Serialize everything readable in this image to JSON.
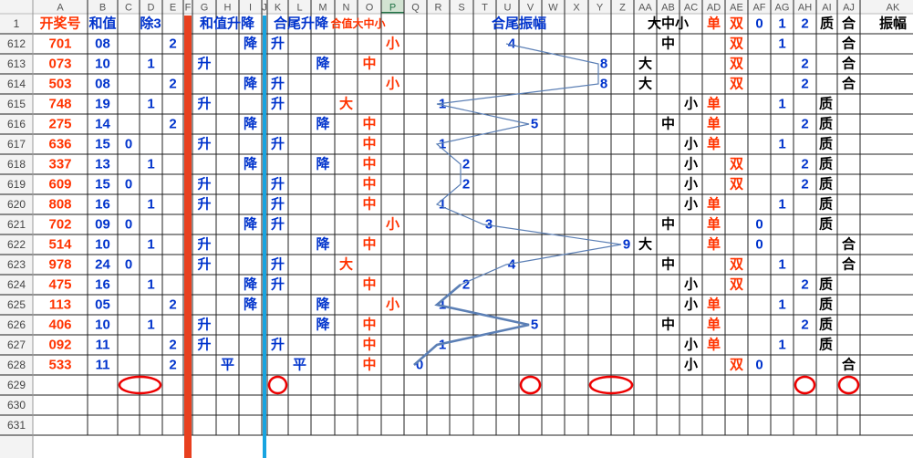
{
  "columns": [
    "A",
    "B",
    "C",
    "D",
    "E",
    "F",
    "G",
    "H",
    "I",
    "J",
    "K",
    "L",
    "M",
    "N",
    "O",
    "P",
    "Q",
    "R",
    "S",
    "T",
    "U",
    "V",
    "W",
    "X",
    "Y",
    "Z",
    "AA",
    "AB",
    "AC",
    "AD",
    "AE",
    "AF",
    "AG",
    "AH",
    "AI",
    "AJ",
    "AK"
  ],
  "selected_column": "P",
  "header_row": {
    "row_number": "1",
    "cells": [
      {
        "col": "A",
        "text": "开奖号",
        "color": "#ff3300"
      },
      {
        "col": "B",
        "text": "和值",
        "color": "#0033cc"
      },
      {
        "col": "C",
        "span": "E",
        "text": "除3",
        "color": "#0033cc"
      },
      {
        "col": "G",
        "span": "I",
        "text": "和值升降",
        "color": "#0033cc"
      },
      {
        "col": "K",
        "span": "M",
        "text": "合尾升降",
        "color": "#0033cc"
      },
      {
        "col": "N",
        "span": "O",
        "text": "合值大中小",
        "color": "#ff3300",
        "small": true
      },
      {
        "col": "Q",
        "span": "Z",
        "text": "合尾振幅",
        "color": "#0033cc"
      },
      {
        "col": "AA",
        "span": "AC",
        "text": "大中小",
        "color": "#000000"
      },
      {
        "col": "AD",
        "text": "单",
        "color": "#ff3300"
      },
      {
        "col": "AE",
        "text": "双",
        "color": "#ff3300"
      },
      {
        "col": "AF",
        "text": "0",
        "color": "#0033cc"
      },
      {
        "col": "AG",
        "text": "1",
        "color": "#0033cc"
      },
      {
        "col": "AH",
        "text": "2",
        "color": "#0033cc"
      },
      {
        "col": "AI",
        "text": "质",
        "color": "#000000"
      },
      {
        "col": "AJ",
        "text": "合",
        "color": "#000000"
      },
      {
        "col": "AK",
        "text": "振幅",
        "color": "#000000"
      }
    ]
  },
  "rows": [
    {
      "row": "612",
      "number": "701",
      "sum": "08",
      "mod3": {
        "col": "E",
        "v": "2"
      },
      "sum_trend": {
        "col": "I",
        "v": "降"
      },
      "tail_trend": {
        "col": "K",
        "v": "升"
      },
      "size": {
        "col": "P",
        "v": "小"
      },
      "amp": "4",
      "dzx": {
        "col": "AB",
        "v": "中"
      },
      "parity": {
        "col": "AE",
        "v": "双"
      },
      "r3": {
        "col": "AG",
        "v": "1"
      },
      "pc": "合"
    },
    {
      "row": "613",
      "number": "073",
      "sum": "10",
      "mod3": {
        "col": "D",
        "v": "1"
      },
      "sum_trend": {
        "col": "G",
        "v": "升"
      },
      "tail_trend": {
        "col": "M",
        "v": "降"
      },
      "size": {
        "col": "O",
        "v": "中"
      },
      "amp": "8",
      "dzx": {
        "col": "AA",
        "v": "大"
      },
      "parity": {
        "col": "AE",
        "v": "双"
      },
      "r3": {
        "col": "AH",
        "v": "2"
      },
      "pc": "合"
    },
    {
      "row": "614",
      "number": "503",
      "sum": "08",
      "mod3": {
        "col": "E",
        "v": "2"
      },
      "sum_trend": {
        "col": "I",
        "v": "降"
      },
      "tail_trend": {
        "col": "K",
        "v": "升"
      },
      "size": {
        "col": "P",
        "v": "小"
      },
      "amp": "8",
      "dzx": {
        "col": "AA",
        "v": "大"
      },
      "parity": {
        "col": "AE",
        "v": "双"
      },
      "r3": {
        "col": "AH",
        "v": "2"
      },
      "pc": "合"
    },
    {
      "row": "615",
      "number": "748",
      "sum": "19",
      "mod3": {
        "col": "D",
        "v": "1"
      },
      "sum_trend": {
        "col": "G",
        "v": "升"
      },
      "tail_trend": {
        "col": "K",
        "v": "升"
      },
      "size": {
        "col": "N",
        "v": "大"
      },
      "amp": "1",
      "dzx": {
        "col": "AC",
        "v": "小"
      },
      "parity": {
        "col": "AD",
        "v": "单"
      },
      "r3": {
        "col": "AG",
        "v": "1"
      },
      "pc": "质"
    },
    {
      "row": "616",
      "number": "275",
      "sum": "14",
      "mod3": {
        "col": "E",
        "v": "2"
      },
      "sum_trend": {
        "col": "I",
        "v": "降"
      },
      "tail_trend": {
        "col": "M",
        "v": "降"
      },
      "size": {
        "col": "O",
        "v": "中"
      },
      "amp": "5",
      "dzx": {
        "col": "AB",
        "v": "中"
      },
      "parity": {
        "col": "AD",
        "v": "单"
      },
      "r3": {
        "col": "AH",
        "v": "2"
      },
      "pc": "质"
    },
    {
      "row": "617",
      "number": "636",
      "sum": "15",
      "mod3": {
        "col": "C",
        "v": "0"
      },
      "sum_trend": {
        "col": "G",
        "v": "升"
      },
      "tail_trend": {
        "col": "K",
        "v": "升"
      },
      "size": {
        "col": "O",
        "v": "中"
      },
      "amp": "1",
      "dzx": {
        "col": "AC",
        "v": "小"
      },
      "parity": {
        "col": "AD",
        "v": "单"
      },
      "r3": {
        "col": "AG",
        "v": "1"
      },
      "pc": "质"
    },
    {
      "row": "618",
      "number": "337",
      "sum": "13",
      "mod3": {
        "col": "D",
        "v": "1"
      },
      "sum_trend": {
        "col": "I",
        "v": "降"
      },
      "tail_trend": {
        "col": "M",
        "v": "降"
      },
      "size": {
        "col": "O",
        "v": "中"
      },
      "amp": "2",
      "dzx": {
        "col": "AC",
        "v": "小"
      },
      "parity": {
        "col": "AE",
        "v": "双"
      },
      "r3": {
        "col": "AH",
        "v": "2"
      },
      "pc": "质"
    },
    {
      "row": "619",
      "number": "609",
      "sum": "15",
      "mod3": {
        "col": "C",
        "v": "0"
      },
      "sum_trend": {
        "col": "G",
        "v": "升"
      },
      "tail_trend": {
        "col": "K",
        "v": "升"
      },
      "size": {
        "col": "O",
        "v": "中"
      },
      "amp": "2",
      "dzx": {
        "col": "AC",
        "v": "小"
      },
      "parity": {
        "col": "AE",
        "v": "双"
      },
      "r3": {
        "col": "AH",
        "v": "2"
      },
      "pc": "质"
    },
    {
      "row": "620",
      "number": "808",
      "sum": "16",
      "mod3": {
        "col": "D",
        "v": "1"
      },
      "sum_trend": {
        "col": "G",
        "v": "升"
      },
      "tail_trend": {
        "col": "K",
        "v": "升"
      },
      "size": {
        "col": "O",
        "v": "中"
      },
      "amp": "1",
      "dzx": {
        "col": "AC",
        "v": "小"
      },
      "parity": {
        "col": "AD",
        "v": "单"
      },
      "r3": {
        "col": "AG",
        "v": "1"
      },
      "pc": "质"
    },
    {
      "row": "621",
      "number": "702",
      "sum": "09",
      "mod3": {
        "col": "C",
        "v": "0"
      },
      "sum_trend": {
        "col": "I",
        "v": "降"
      },
      "tail_trend": {
        "col": "K",
        "v": "升"
      },
      "size": {
        "col": "P",
        "v": "小"
      },
      "amp": "3",
      "dzx": {
        "col": "AB",
        "v": "中"
      },
      "parity": {
        "col": "AD",
        "v": "单"
      },
      "r3": {
        "col": "AF",
        "v": "0"
      },
      "pc": "质"
    },
    {
      "row": "622",
      "number": "514",
      "sum": "10",
      "mod3": {
        "col": "D",
        "v": "1"
      },
      "sum_trend": {
        "col": "G",
        "v": "升"
      },
      "tail_trend": {
        "col": "M",
        "v": "降"
      },
      "size": {
        "col": "O",
        "v": "中"
      },
      "amp": "9",
      "dzx": {
        "col": "AA",
        "v": "大"
      },
      "parity": {
        "col": "AD",
        "v": "单"
      },
      "r3": {
        "col": "AF",
        "v": "0"
      },
      "pc": "合"
    },
    {
      "row": "623",
      "number": "978",
      "sum": "24",
      "mod3": {
        "col": "C",
        "v": "0"
      },
      "sum_trend": {
        "col": "G",
        "v": "升"
      },
      "tail_trend": {
        "col": "K",
        "v": "升"
      },
      "size": {
        "col": "N",
        "v": "大"
      },
      "amp": "4",
      "dzx": {
        "col": "AB",
        "v": "中"
      },
      "parity": {
        "col": "AE",
        "v": "双"
      },
      "r3": {
        "col": "AG",
        "v": "1"
      },
      "pc": "合"
    },
    {
      "row": "624",
      "number": "475",
      "sum": "16",
      "mod3": {
        "col": "D",
        "v": "1"
      },
      "sum_trend": {
        "col": "I",
        "v": "降"
      },
      "tail_trend": {
        "col": "K",
        "v": "升"
      },
      "size": {
        "col": "O",
        "v": "中"
      },
      "amp": "2",
      "dzx": {
        "col": "AC",
        "v": "小"
      },
      "parity": {
        "col": "AE",
        "v": "双"
      },
      "r3": {
        "col": "AH",
        "v": "2"
      },
      "pc": "质"
    },
    {
      "row": "625",
      "number": "113",
      "sum": "05",
      "mod3": {
        "col": "E",
        "v": "2"
      },
      "sum_trend": {
        "col": "I",
        "v": "降"
      },
      "tail_trend": {
        "col": "M",
        "v": "降"
      },
      "size": {
        "col": "P",
        "v": "小"
      },
      "amp": "1",
      "dzx": {
        "col": "AC",
        "v": "小"
      },
      "parity": {
        "col": "AD",
        "v": "单"
      },
      "r3": {
        "col": "AG",
        "v": "1"
      },
      "pc": "质"
    },
    {
      "row": "626",
      "number": "406",
      "sum": "10",
      "mod3": {
        "col": "D",
        "v": "1"
      },
      "sum_trend": {
        "col": "G",
        "v": "升"
      },
      "tail_trend": {
        "col": "M",
        "v": "降"
      },
      "size": {
        "col": "O",
        "v": "中"
      },
      "amp": "5",
      "dzx": {
        "col": "AB",
        "v": "中"
      },
      "parity": {
        "col": "AD",
        "v": "单"
      },
      "r3": {
        "col": "AH",
        "v": "2"
      },
      "pc": "质"
    },
    {
      "row": "627",
      "number": "092",
      "sum": "11",
      "mod3": {
        "col": "E",
        "v": "2"
      },
      "sum_trend": {
        "col": "G",
        "v": "升"
      },
      "tail_trend": {
        "col": "K",
        "v": "升"
      },
      "size": {
        "col": "O",
        "v": "中"
      },
      "amp": "1",
      "dzx": {
        "col": "AC",
        "v": "小"
      },
      "parity": {
        "col": "AD",
        "v": "单"
      },
      "r3": {
        "col": "AG",
        "v": "1"
      },
      "pc": "质"
    },
    {
      "row": "628",
      "number": "533",
      "sum": "11",
      "mod3": {
        "col": "E",
        "v": "2"
      },
      "sum_trend": {
        "col": "H",
        "v": "平"
      },
      "tail_trend": {
        "col": "L",
        "v": "平"
      },
      "size": {
        "col": "O",
        "v": "中"
      },
      "amp": "0",
      "dzx": {
        "col": "AC",
        "v": "小"
      },
      "parity": {
        "col": "AE",
        "v": "双"
      },
      "r3": {
        "col": "AF",
        "v": "0"
      },
      "pc": "合"
    }
  ],
  "empty_rows": [
    "629",
    "630",
    "631"
  ],
  "thick_lines": [
    {
      "col": "F",
      "color": "#e8401f"
    },
    {
      "col": "J",
      "color": "#18a4e0"
    }
  ],
  "circles": [
    {
      "row": "629",
      "from": "C",
      "to": "D"
    },
    {
      "row": "629",
      "from": "K",
      "to": "K"
    },
    {
      "row": "629",
      "from": "V",
      "to": "V"
    },
    {
      "row": "629",
      "from": "Y",
      "to": "Z"
    },
    {
      "row": "629",
      "from": "AH",
      "to": "AH"
    },
    {
      "row": "629",
      "from": "AJ",
      "to": "AJ"
    }
  ],
  "colors": {
    "number": "#ff3300",
    "blue_text": "#0033cc",
    "red_text": "#ff3300",
    "black_text": "#000000",
    "amp_line": "#5b7fb5",
    "circle": "#ee0000",
    "header_bg": "#f3f3f3",
    "grid": "#000000"
  }
}
